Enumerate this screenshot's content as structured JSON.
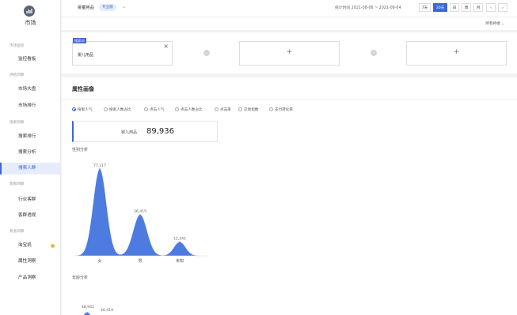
{
  "sidebar": {
    "logo_text": "市场",
    "groups": [
      {
        "title": "市场监控",
        "items": [
          {
            "label": "监控看板",
            "active": false
          }
        ]
      },
      {
        "title": "供给洞察",
        "items": [
          {
            "label": "市场大盘",
            "active": false
          },
          {
            "label": "市场排行",
            "active": false
          }
        ]
      },
      {
        "title": "搜索洞察",
        "items": [
          {
            "label": "搜索排行",
            "active": false
          },
          {
            "label": "搜索分析",
            "active": false
          },
          {
            "label": "搜索人群",
            "active": true
          }
        ]
      },
      {
        "title": "客群洞察",
        "items": [
          {
            "label": "行业客群",
            "active": false
          },
          {
            "label": "客群透视",
            "active": false
          }
        ]
      },
      {
        "title": "机会洞察",
        "items": [
          {
            "label": "淘宝机",
            "active": false,
            "dot": true
          },
          {
            "label": "属性洞察",
            "active": false
          },
          {
            "label": "产品洞察",
            "active": false
          }
        ]
      }
    ]
  },
  "topbar": {
    "category": "婴童用品",
    "edition_badge": "专业版",
    "date_range": "统计时间 2021-08-06 ~ 2021-09-04",
    "range_buttons": [
      {
        "label": "7天",
        "active": false
      },
      {
        "label": "30天",
        "active": true
      },
      {
        "label": "日",
        "active": false
      },
      {
        "label": "周",
        "active": false
      },
      {
        "label": "月",
        "active": false
      },
      {
        "label": "‹",
        "active": false
      },
      {
        "label": "›",
        "active": false
      }
    ]
  },
  "subbar": {
    "terminal": "所有终端 ⌄"
  },
  "compare": {
    "card1": {
      "tag": "搜索词",
      "name": "婴儿用品",
      "close": "×"
    },
    "plus": "+"
  },
  "attr": {
    "title": "属性画像",
    "tabs": [
      {
        "label": "搜索人气",
        "checked": true
      },
      {
        "label": "搜索人数占比",
        "checked": false
      },
      {
        "label": "点击人气",
        "checked": false
      },
      {
        "label": "点击人数占比",
        "checked": false
      },
      {
        "label": "点击率",
        "checked": false
      },
      {
        "label": "交易指数",
        "checked": false
      },
      {
        "label": "支付转化率",
        "checked": false
      }
    ],
    "metric": {
      "label": "婴儿用品",
      "value": "89,936"
    },
    "gender_title": "性别分析",
    "age_title": "年龄分析"
  },
  "chart_data": {
    "type": "area",
    "title": "性别分析",
    "categories": [
      "女",
      "男",
      "未知"
    ],
    "values": [
      77217,
      36415,
      12241
    ],
    "value_labels": [
      "77,217",
      "36,415",
      "12,241"
    ],
    "color": "#4d7be0",
    "grid": false
  },
  "age_preview": {
    "value_labels": [
      "48,942",
      "40,419"
    ]
  }
}
